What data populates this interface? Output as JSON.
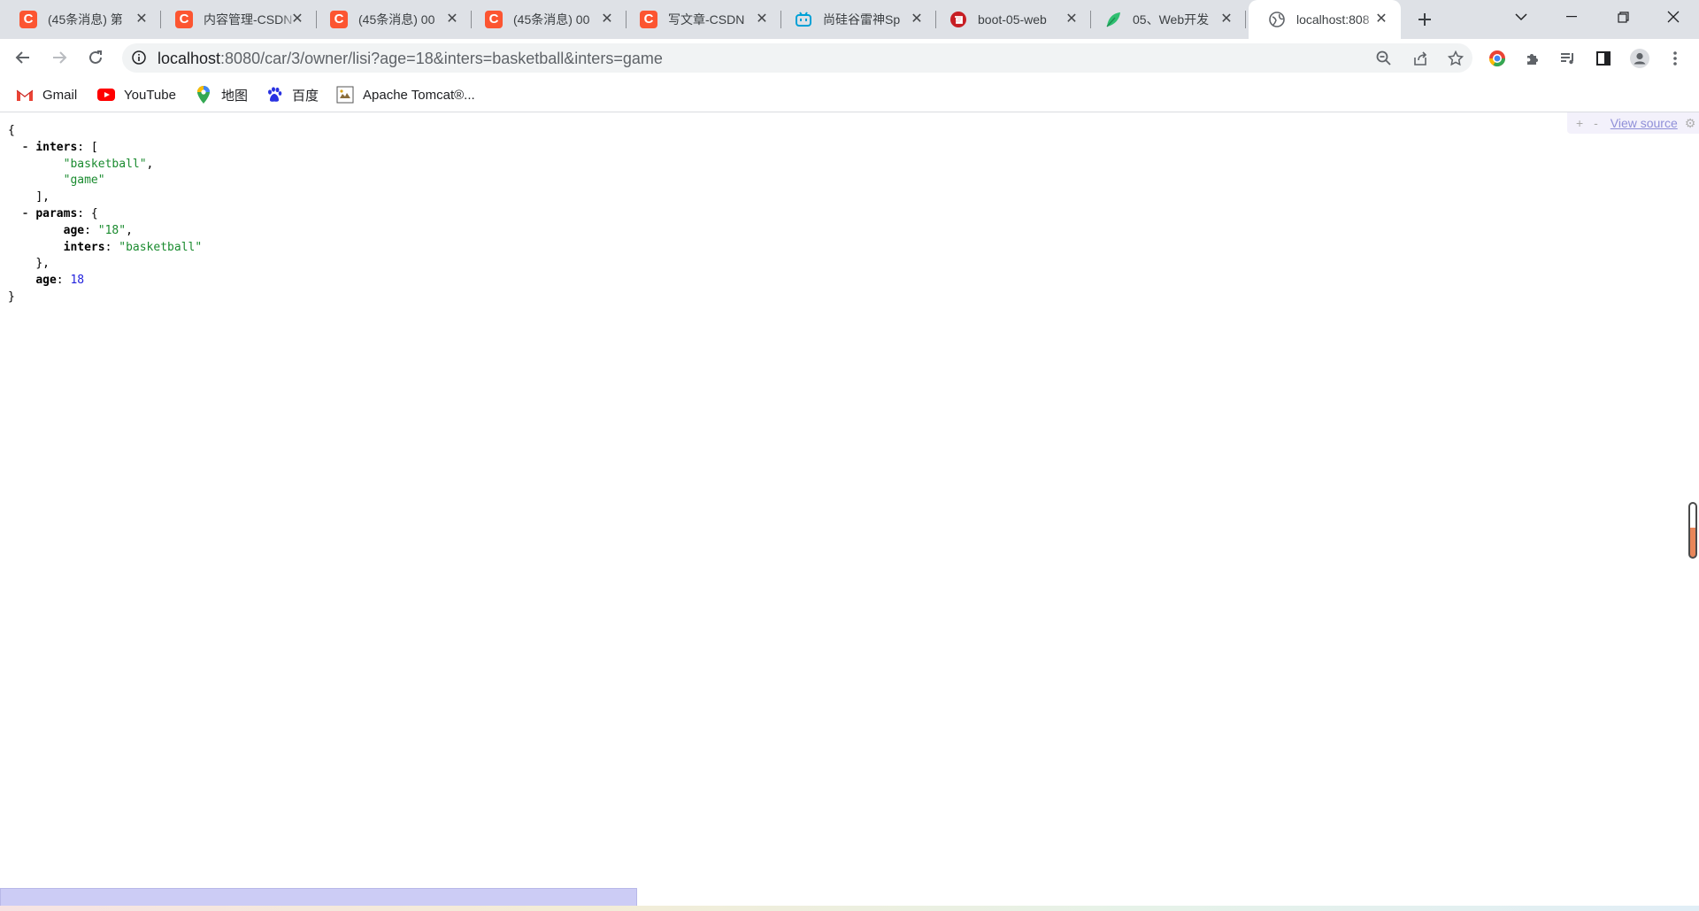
{
  "tabs": [
    {
      "title": "(45条消息) 第",
      "favicon": "csdn-icon"
    },
    {
      "title": "内容管理-CSDN",
      "favicon": "csdn-icon"
    },
    {
      "title": "(45条消息) 00",
      "favicon": "csdn-icon"
    },
    {
      "title": "(45条消息) 00",
      "favicon": "csdn-icon"
    },
    {
      "title": "写文章-CSDN",
      "favicon": "csdn-icon"
    },
    {
      "title": "尚硅谷雷神Sp",
      "favicon": "bilibili-icon"
    },
    {
      "title": "boot-05-web",
      "favicon": "gitee-icon"
    },
    {
      "title": "05、Web开发",
      "favicon": "leaf-icon"
    },
    {
      "title": "localhost:808",
      "favicon": "globe-icon",
      "active": true
    }
  ],
  "address_bar": {
    "host": "localhost",
    "path": ":8080/car/3/owner/lisi?age=18&inters=basketball&inters=game"
  },
  "bookmarks": [
    {
      "label": "Gmail",
      "icon": "gmail-icon"
    },
    {
      "label": "YouTube",
      "icon": "youtube-icon"
    },
    {
      "label": "地图",
      "icon": "maps-pin-icon"
    },
    {
      "label": "百度",
      "icon": "baidu-paw-icon"
    },
    {
      "label": "Apache Tomcat®...",
      "icon": "tomcat-icon"
    }
  ],
  "json_viewer": {
    "controls": {
      "expand": "+",
      "collapse": "-",
      "view_source": "View source"
    },
    "lines": {
      "open": "{",
      "inters_key": "inters",
      "inters_open": ": [",
      "inters_0": "\"basketball\"",
      "inters_1": "\"game\"",
      "inters_close": "],",
      "params_key": "params",
      "params_open": ": {",
      "params_age_key": "age",
      "params_age_val": "\"18\"",
      "params_inters_key": "inters",
      "params_inters_val": "\"basketball\"",
      "params_close": "},",
      "age_key": "age",
      "age_val": "18",
      "close": "}"
    },
    "toggle": "-"
  },
  "colors": {
    "string": "#1a8b2f",
    "number": "#2222dd",
    "csdn": "#fc5531",
    "tabstrip": "#dee1e6"
  }
}
